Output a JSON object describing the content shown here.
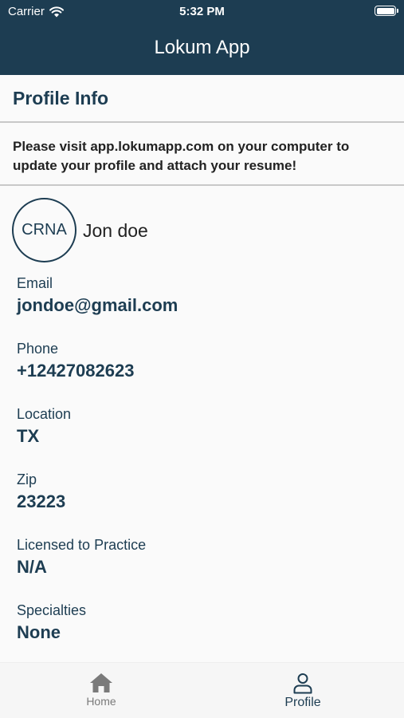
{
  "status_bar": {
    "carrier": "Carrier",
    "time": "5:32 PM"
  },
  "header": {
    "title": "Lokum App"
  },
  "section": {
    "title": "Profile Info"
  },
  "notice": {
    "text": "Please visit app.lokumapp.com on your computer to update your profile and attach your resume!"
  },
  "profile": {
    "avatar_text": "CRNA",
    "name": "Jon doe",
    "fields": [
      {
        "label": "Email",
        "value": "jondoe@gmail.com"
      },
      {
        "label": "Phone",
        "value": "+12427082623"
      },
      {
        "label": "Location",
        "value": "TX"
      },
      {
        "label": "Zip",
        "value": "23223"
      },
      {
        "label": "Licensed to Practice",
        "value": "N/A"
      },
      {
        "label": "Specialties",
        "value": "None"
      }
    ]
  },
  "tabbar": {
    "items": [
      {
        "label": "Home",
        "icon": "home-icon",
        "active": false
      },
      {
        "label": "Profile",
        "icon": "person-icon",
        "active": true
      }
    ]
  },
  "colors": {
    "primary": "#1d3d52",
    "background": "#fafafa",
    "inactive": "#7a7a7a"
  }
}
